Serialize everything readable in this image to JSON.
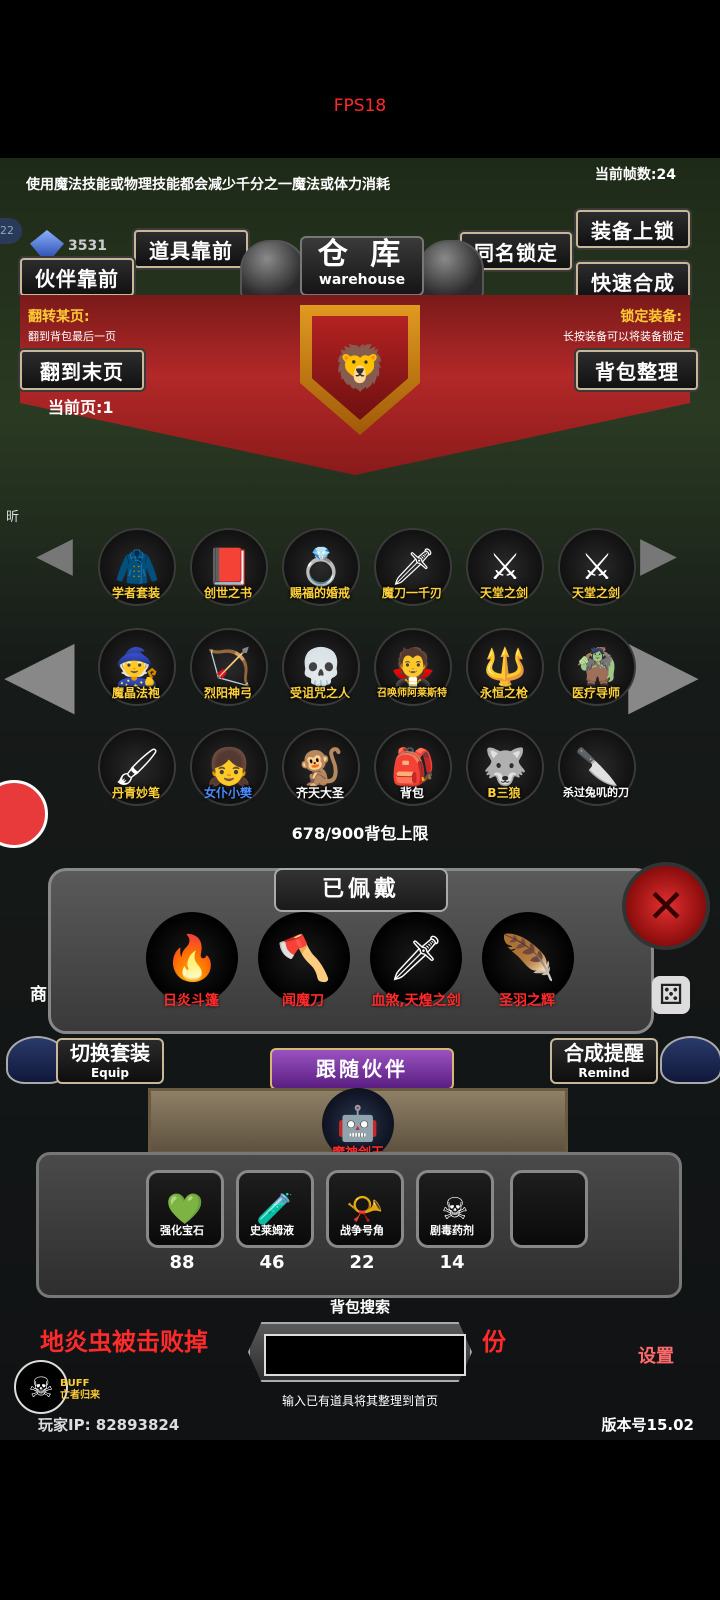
{
  "fps": "FPS18",
  "tip": "使用魔法技能或物理技能都会减少千分之一魔法或体力消耗",
  "frame_count": "当前帧数:24",
  "gold": "3531",
  "level": "22",
  "buttons": {
    "item_front": "道具靠前",
    "partner_front": "伙伴靠前",
    "same_name_lock": "同名锁定",
    "equip_lock": "装备上锁",
    "quick_merge": "快速合成",
    "to_last_page": "翻到末页",
    "bag_sort": "背包整理"
  },
  "title": {
    "cn": "仓 库",
    "en": "warehouse"
  },
  "flip_page": {
    "label": "翻转某页:",
    "desc": "翻到背包最后一页"
  },
  "lock_equip": {
    "label": "锁定装备:",
    "desc": "长按装备可以将装备锁定"
  },
  "current_page": "当前页:1",
  "items": [
    {
      "name": "学者套装",
      "icon": "🧥"
    },
    {
      "name": "创世之书",
      "icon": "📕"
    },
    {
      "name": "赐福的婚戒",
      "icon": "💍"
    },
    {
      "name": "魔刀一千刃",
      "icon": "🗡"
    },
    {
      "name": "天堂之剑",
      "icon": "⚔"
    },
    {
      "name": "天堂之剑",
      "icon": "⚔"
    },
    {
      "name": "魔晶法袍",
      "icon": "🧙"
    },
    {
      "name": "烈阳神弓",
      "icon": "🏹"
    },
    {
      "name": "受诅咒之人",
      "icon": "💀"
    },
    {
      "name": "召唤师阿莱斯特",
      "icon": "🧛"
    },
    {
      "name": "永恒之枪",
      "icon": "🔱"
    },
    {
      "name": "医疗导师",
      "icon": "🧌"
    },
    {
      "name": "丹青妙笔",
      "icon": "🖌"
    },
    {
      "name": "女仆小樊",
      "icon": "👧"
    },
    {
      "name": "齐天大圣",
      "icon": "🐒"
    },
    {
      "name": "背包",
      "icon": "🎒"
    },
    {
      "name": "B三狼",
      "icon": "🐺"
    },
    {
      "name": "杀过兔叽的刀",
      "icon": "🔪"
    }
  ],
  "bag_capacity": "678/900背包上限",
  "worn_title": "已佩戴",
  "equipped": [
    {
      "name": "日炎斗篷",
      "icon": "🔥"
    },
    {
      "name": "闻魔刀",
      "icon": "🪓"
    },
    {
      "name": "血煞,天煌之剑",
      "icon": "🗡"
    },
    {
      "name": "圣羽之辉",
      "icon": "🪶"
    }
  ],
  "switch_set": {
    "cn": "切换套装",
    "en": "Equip"
  },
  "merge_remind": {
    "cn": "合成提醒",
    "en": "Remind"
  },
  "follow_partner": "跟随伙伴",
  "partner": {
    "name": "魔神剑王",
    "icon": "🤖"
  },
  "consumables": [
    {
      "name": "强化宝石",
      "count": "88",
      "icon": "💚"
    },
    {
      "name": "史莱姆液",
      "count": "46",
      "icon": "🧪"
    },
    {
      "name": "战争号角",
      "count": "22",
      "icon": "📯"
    },
    {
      "name": "剧毒药剂",
      "count": "14",
      "icon": "☠"
    }
  ],
  "bag_search": {
    "label": "背包搜索",
    "hint": "输入已有道具将其整理到首页",
    "value": ""
  },
  "bg_text": "地炎虫被击败掉",
  "bg_text_suffix": "份",
  "shop": "商",
  "setting": "设置",
  "buff": {
    "line1": "BUFF",
    "line2": "亡者归来"
  },
  "player_ip": "玩家IP: 82893824",
  "version": "版本号15.02",
  "side_text": "昕",
  "dice_icon": "⚄",
  "close_icon": "✕",
  "skull_icon": "☠",
  "lion_icon": "🦁"
}
